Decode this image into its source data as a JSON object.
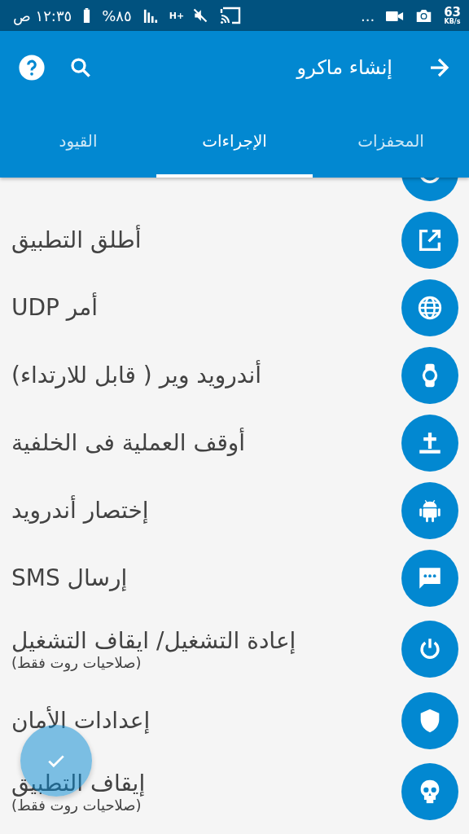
{
  "status_bar": {
    "time": "١٢:٣٥ ص",
    "battery": "%٨٥",
    "network": "H+",
    "speed": "63",
    "speed_unit": "KB/s",
    "more": "..."
  },
  "toolbar": {
    "title": "إنشاء ماكرو"
  },
  "tabs": [
    {
      "label": "المحفزات",
      "selected": false
    },
    {
      "label": "الإجراءات",
      "selected": true
    },
    {
      "label": "القيود",
      "selected": false
    }
  ],
  "actions": [
    {
      "kind": "awake",
      "cut_off": true
    },
    {
      "kind": "launch",
      "title": "أطلق التطبيق",
      "cut_off": false
    },
    {
      "kind": "globe",
      "title": "أمر UDP",
      "cut_off": false
    },
    {
      "kind": "watch",
      "title": "أندرويد وير ( قابل للارتداء)",
      "cut_off": false
    },
    {
      "kind": "grave",
      "title": "أوقف العملية فى الخلفية",
      "cut_off": false
    },
    {
      "kind": "android",
      "title": "إختصار أندرويد",
      "cut_off": false
    },
    {
      "kind": "sms",
      "title": "إرسال SMS",
      "cut_off": false
    },
    {
      "kind": "power",
      "title": "إعادة التشغيل/ ايقاف التشغيل",
      "note": "(صلاحيات روت فقط)",
      "cut_off": false
    },
    {
      "kind": "shield",
      "title": "إعدادات الأمان",
      "cut_off": false
    },
    {
      "kind": "skull",
      "title": "إيقاف التطبيق",
      "note": "(صلاحيات روت فقط)",
      "cut_off": false
    }
  ]
}
